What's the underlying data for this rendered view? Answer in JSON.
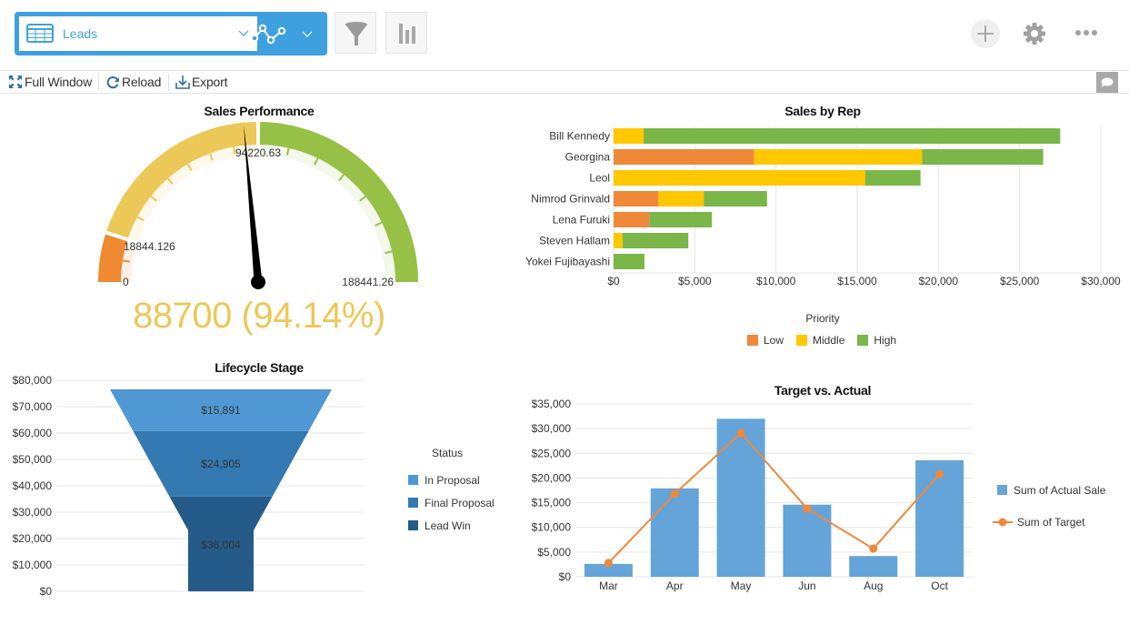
{
  "header": {
    "object_picker": {
      "icon": "table-icon",
      "label": "Leads"
    },
    "viz_picker": {
      "icon": "line-chart-icon"
    },
    "filter_button": {
      "icon": "funnel-icon"
    },
    "chart_button": {
      "icon": "bar-chart-icon"
    },
    "right_actions": [
      {
        "name": "add",
        "icon": "plus-icon"
      },
      {
        "name": "settings",
        "icon": "gear-icon"
      },
      {
        "name": "more",
        "icon": "ellipsis-icon"
      }
    ]
  },
  "toolbar": {
    "full_window": "Full Window",
    "reload": "Reload",
    "export": "Export",
    "comment_icon": "comment-icon"
  },
  "colors": {
    "accent": "#3fa0e0",
    "low": "#f0883a",
    "middle": "#ffc700",
    "high": "#7ab648",
    "gauge_yellow": "#ecc858",
    "gauge_green": "#97c046",
    "gauge_orange": "#ef8a32",
    "funnel": [
      "#4f98d3",
      "#3479b2",
      "#245b88"
    ],
    "actual_bar": "#65a4d8",
    "target_line": "#f0883a"
  },
  "chart_data": [
    {
      "id": "gauge",
      "type": "gauge",
      "title": "Sales Performance",
      "min": 0,
      "max": 188441.26,
      "bands": [
        {
          "from": 0,
          "to": 18844.126,
          "color": "#ef8a32"
        },
        {
          "from": 18844.126,
          "to": 94220.63,
          "color": "#ecc858"
        },
        {
          "from": 94220.63,
          "to": 188441.26,
          "color": "#97c046"
        }
      ],
      "tick_labels": [
        "0",
        "18844.126",
        "94220.63",
        "188441.26"
      ],
      "value": 88700,
      "value_label": "88700 (94.14%)"
    },
    {
      "id": "sales-by-rep",
      "type": "bar",
      "orientation": "horizontal",
      "stacked": true,
      "title": "Sales by Rep",
      "categories": [
        "Bill Kennedy",
        "Georgina",
        "Leol",
        "Nimrod Grinvald",
        "Lena Furuki",
        "Steven Hallam",
        "Yokei Fujibayashi"
      ],
      "series": [
        {
          "name": "Low",
          "color": "#f0883a",
          "values": [
            0,
            8650,
            0,
            2750,
            2200,
            0,
            0
          ]
        },
        {
          "name": "Middle",
          "color": "#ffc700",
          "values": [
            1850,
            10350,
            15500,
            2800,
            0,
            550,
            0
          ]
        },
        {
          "name": "High",
          "color": "#7ab648",
          "values": [
            25650,
            7450,
            3400,
            3900,
            3850,
            4050,
            1900
          ]
        }
      ],
      "xlim": [
        0,
        30000
      ],
      "xticks": [
        "$0",
        "$5,000",
        "$10,000",
        "$15,000",
        "$20,000",
        "$25,000",
        "$30,000"
      ],
      "grid": true,
      "legend_title": "Priority",
      "legend_position": "bottom"
    },
    {
      "id": "lifecycle",
      "type": "funnel",
      "title": "Lifecycle Stage",
      "categories": [
        "In Proposal",
        "Final Proposal",
        "Lead Win"
      ],
      "values": [
        15891,
        24905,
        36004
      ],
      "value_labels": [
        "$15,891",
        "$24,905",
        "$36,004"
      ],
      "colors": [
        "#4f98d3",
        "#3479b2",
        "#245b88"
      ],
      "ylim": [
        0,
        80000
      ],
      "yticks": [
        "$0",
        "$10,000",
        "$20,000",
        "$30,000",
        "$40,000",
        "$50,000",
        "$60,000",
        "$70,000",
        "$80,000"
      ],
      "legend_title": "Status",
      "legend_position": "right"
    },
    {
      "id": "target-vs-actual",
      "type": "bar",
      "title": "Target vs. Actual",
      "categories": [
        "Mar",
        "Apr",
        "May",
        "Jun",
        "Aug",
        "Oct"
      ],
      "series": [
        {
          "name": "Sum of Actual Sale",
          "kind": "bar",
          "color": "#65a4d8",
          "values": [
            2600,
            17900,
            32000,
            14600,
            4200,
            23600
          ]
        },
        {
          "name": "Sum of Target",
          "kind": "line",
          "color": "#f0883a",
          "values": [
            2800,
            16800,
            29100,
            13800,
            5700,
            20800
          ]
        }
      ],
      "ylim": [
        0,
        35000
      ],
      "yticks": [
        "$0",
        "$5,000",
        "$10,000",
        "$15,000",
        "$20,000",
        "$25,000",
        "$30,000",
        "$35,000"
      ],
      "grid": true,
      "legend_position": "right"
    }
  ]
}
